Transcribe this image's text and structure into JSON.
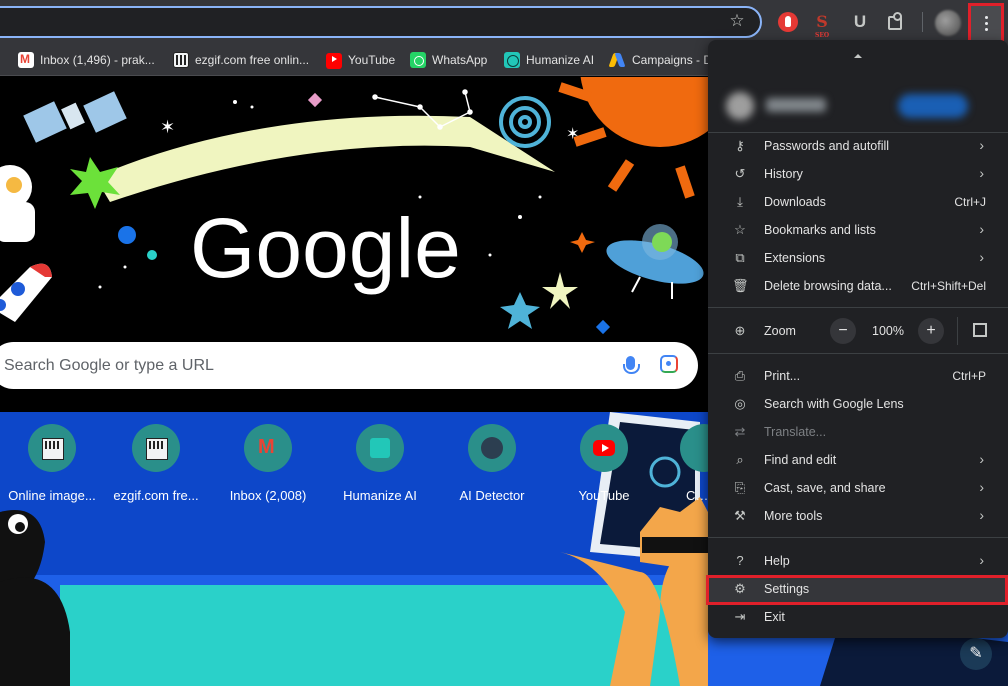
{
  "bookmarks": [
    {
      "label": "Inbox (1,496) - prak...",
      "icon": "gmail-icon"
    },
    {
      "label": "ezgif.com free onlin...",
      "icon": "ezgif-icon"
    },
    {
      "label": "YouTube",
      "icon": "youtube-icon"
    },
    {
      "label": "WhatsApp",
      "icon": "whatsapp-icon"
    },
    {
      "label": "Humanize AI",
      "icon": "humanize-icon"
    },
    {
      "label": "Campaigns - D",
      "icon": "google-ads-icon"
    }
  ],
  "ntp": {
    "logo": "Google",
    "search_placeholder": "Search Google or type a URL",
    "shortcuts": [
      {
        "label": "Online image...",
        "icon": "ezgif-icon"
      },
      {
        "label": "ezgif.com fre...",
        "icon": "ezgif-icon"
      },
      {
        "label": "Inbox (2,008)",
        "icon": "gmail-icon"
      },
      {
        "label": "Humanize AI",
        "icon": "humanize-icon"
      },
      {
        "label": "AI Detector",
        "icon": "ai-detector-icon"
      },
      {
        "label": "YouTube",
        "icon": "youtube-icon"
      },
      {
        "label": "Cam",
        "icon": "campaigns-icon"
      }
    ]
  },
  "menu": {
    "items": [
      {
        "label": "Passwords and autofill",
        "icon": "key-icon",
        "submenu": true
      },
      {
        "label": "History",
        "icon": "history-icon",
        "submenu": true
      },
      {
        "label": "Downloads",
        "icon": "download-icon",
        "shortcut": "Ctrl+J"
      },
      {
        "label": "Bookmarks and lists",
        "icon": "star-icon",
        "submenu": true
      },
      {
        "label": "Extensions",
        "icon": "puzzle-icon",
        "submenu": true
      },
      {
        "label": "Delete browsing data...",
        "icon": "trash-icon",
        "shortcut": "Ctrl+Shift+Del"
      },
      {
        "label": "Zoom",
        "icon": "zoom-icon"
      },
      {
        "label": "Print...",
        "icon": "print-icon",
        "shortcut": "Ctrl+P"
      },
      {
        "label": "Search with Google Lens",
        "icon": "lens-icon"
      },
      {
        "label": "Translate...",
        "icon": "translate-icon",
        "disabled": true
      },
      {
        "label": "Find and edit",
        "icon": "find-icon",
        "submenu": true
      },
      {
        "label": "Cast, save, and share",
        "icon": "cast-icon",
        "submenu": true
      },
      {
        "label": "More tools",
        "icon": "toolbox-icon",
        "submenu": true
      },
      {
        "label": "Help",
        "icon": "help-icon",
        "submenu": true
      },
      {
        "label": "Settings",
        "icon": "gear-icon",
        "highlighted": true
      },
      {
        "label": "Exit",
        "icon": "exit-icon"
      }
    ],
    "zoom": {
      "value": "100%",
      "minus": "−",
      "plus": "+"
    }
  },
  "colors": {
    "highlight_border": "#e0202a",
    "menu_bg": "#202124",
    "toolbar_bg": "#35363a"
  }
}
